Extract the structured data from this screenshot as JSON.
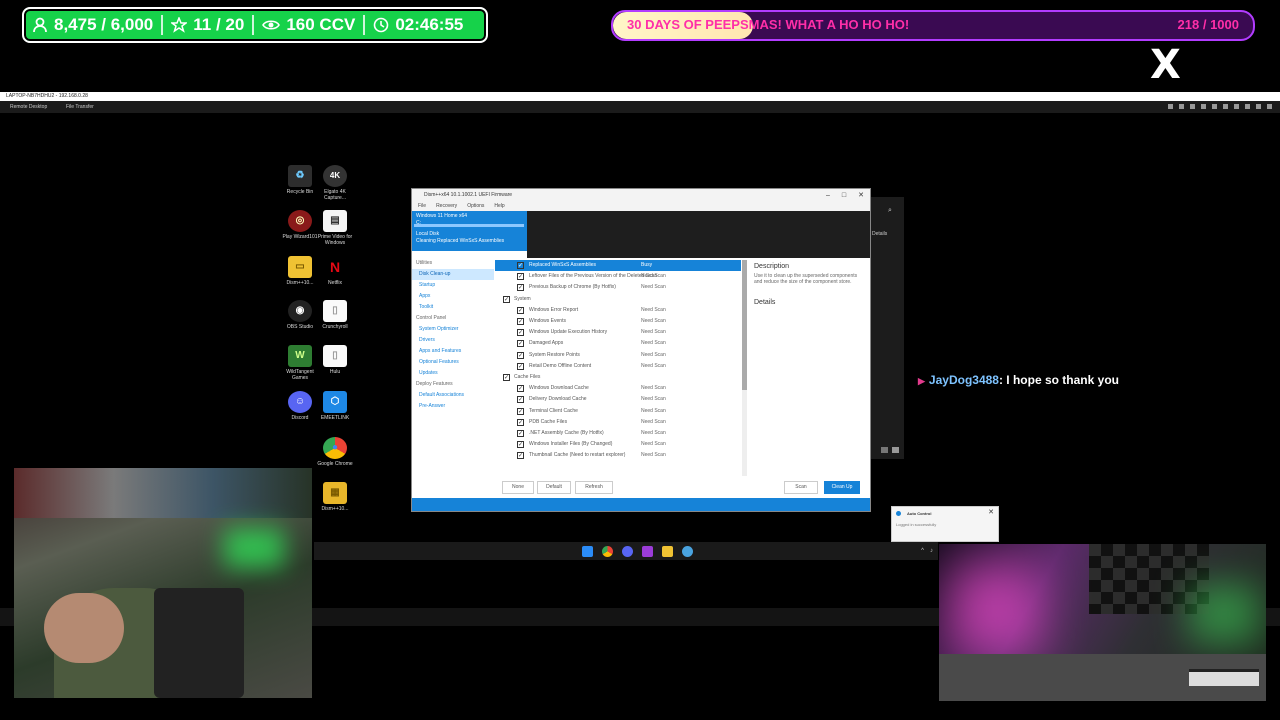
{
  "overlay": {
    "stats": {
      "followers": "8,475 / 6,000",
      "subs": "11 / 20",
      "viewers": "160 CCV",
      "uptime": "02:46:55"
    },
    "goal": {
      "title": "30 DAYS OF PEEPSMAS! WHAT A HO HO HO!",
      "count": "218 / 1000",
      "progress": 0.218
    }
  },
  "remote_desktop": {
    "title": "LAPTOP-NB7HDHU2 - 192.168.0.28",
    "tabs": [
      "Remote Desktop",
      "File Transfer"
    ]
  },
  "desktop_icons": [
    {
      "label": "Recycle Bin",
      "icon": "recycle-bin-icon"
    },
    {
      "label": "Elgato 4K Capture...",
      "icon": "elgato-4k-icon"
    },
    {
      "label": "Play Wizard101",
      "icon": "wizard101-icon"
    },
    {
      "label": "Prime Video for Windows",
      "icon": "prime-video-icon"
    },
    {
      "label": "Dism++10...",
      "icon": "folder-icon"
    },
    {
      "label": "Netflix",
      "icon": "netflix-icon"
    },
    {
      "label": "OBS Studio",
      "icon": "obs-icon"
    },
    {
      "label": "Crunchyroll",
      "icon": "file-icon"
    },
    {
      "label": "WildTangent Games",
      "icon": "wildtangent-icon"
    },
    {
      "label": "Hulu",
      "icon": "file-icon"
    },
    {
      "label": "Discord",
      "icon": "discord-icon"
    },
    {
      "label": "EMEETLINK",
      "icon": "emeetlink-icon"
    },
    {
      "label": "Google Chrome",
      "icon": "chrome-icon"
    },
    {
      "label": "Dism++10...",
      "icon": "archive-icon"
    }
  ],
  "dism": {
    "title": "Dism++x64 10.1.1002.1 UEFI Firmware",
    "menu": [
      "File",
      "Recovery",
      "Options",
      "Help"
    ],
    "header_lines": [
      "Windows 11 Home x64",
      "C:",
      "Local Disk",
      "Cleaning Replaced WinSxS Assemblies"
    ],
    "sidebar": [
      {
        "label": "Utilities",
        "type": "header"
      },
      {
        "label": "Disk Clean-up",
        "type": "selected"
      },
      {
        "label": "Startup",
        "type": "item"
      },
      {
        "label": "Appx",
        "type": "item"
      },
      {
        "label": "Toolkit",
        "type": "item"
      },
      {
        "label": "Control Panel",
        "type": "header"
      },
      {
        "label": "System Optimizer",
        "type": "item"
      },
      {
        "label": "Drivers",
        "type": "item"
      },
      {
        "label": "Apps and Features",
        "type": "item"
      },
      {
        "label": "Optional Features",
        "type": "item"
      },
      {
        "label": "Updates",
        "type": "item"
      },
      {
        "label": "Deploy Features",
        "type": "header"
      },
      {
        "label": "Default Associations",
        "type": "item"
      },
      {
        "label": "Pre-Answer",
        "type": "item"
      }
    ],
    "list": [
      {
        "label": "Replaced WinSxS Assemblies",
        "status": "Busy",
        "kind": "item",
        "highlight": true
      },
      {
        "label": "Leftover Files of the Previous Version of the Deleted Scan",
        "status": "Need Scan",
        "kind": "item"
      },
      {
        "label": "Previous Backup of Chrome (By Hotfix)",
        "status": "Need Scan",
        "kind": "item"
      },
      {
        "label": "System",
        "status": "",
        "kind": "group"
      },
      {
        "label": "Windows Error Report",
        "status": "Need Scan",
        "kind": "item"
      },
      {
        "label": "Windows Events",
        "status": "Need Scan",
        "kind": "item"
      },
      {
        "label": "Windows Update Execution History",
        "status": "Need Scan",
        "kind": "item"
      },
      {
        "label": "Damaged Apps",
        "status": "Need Scan",
        "kind": "item"
      },
      {
        "label": "System Restore Points",
        "status": "Need Scan",
        "kind": "item"
      },
      {
        "label": "Retail Demo Offline Content",
        "status": "Need Scan",
        "kind": "item"
      },
      {
        "label": "Cache Files",
        "status": "",
        "kind": "group"
      },
      {
        "label": "Windows Download Cache",
        "status": "Need Scan",
        "kind": "item"
      },
      {
        "label": "Delivery Download Cache",
        "status": "Need Scan",
        "kind": "item"
      },
      {
        "label": "Terminal Client Cache",
        "status": "Need Scan",
        "kind": "item"
      },
      {
        "label": "PDB Cache Files",
        "status": "Need Scan",
        "kind": "item"
      },
      {
        "label": ".NET Assembly Cache (By Hotfix)",
        "status": "Need Scan",
        "kind": "item"
      },
      {
        "label": "Windows Installer Files (By Changed)",
        "status": "Need Scan",
        "kind": "item"
      },
      {
        "label": "Thumbnail Cache (Need to restart explorer)",
        "status": "Need Scan",
        "kind": "item"
      }
    ],
    "description_title": "Description",
    "description_text": "Use it to clean up the superseded components and reduce the size of the component store.",
    "details_title": "Details",
    "buttons": {
      "none": "None",
      "default": "Default",
      "refresh": "Refresh",
      "scan": "Scan",
      "cleanup": "Clean Up"
    }
  },
  "background_window": {
    "details_label": "Details"
  },
  "chat": {
    "username": "JayDog3488",
    "message": ": I hope so thank you"
  },
  "notification": {
    "title": "Auto Control",
    "text": "Logged in successfully"
  },
  "x_logo": "X"
}
